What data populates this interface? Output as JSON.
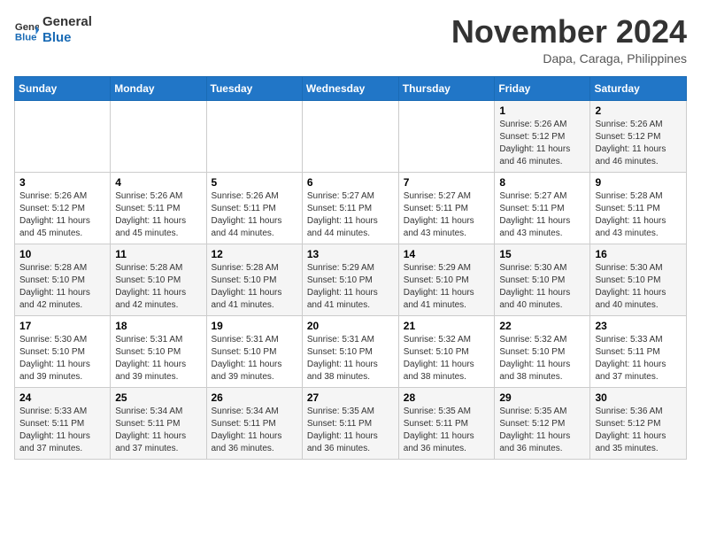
{
  "header": {
    "logo_line1": "General",
    "logo_line2": "Blue",
    "month": "November 2024",
    "location": "Dapa, Caraga, Philippines"
  },
  "weekdays": [
    "Sunday",
    "Monday",
    "Tuesday",
    "Wednesday",
    "Thursday",
    "Friday",
    "Saturday"
  ],
  "weeks": [
    [
      {
        "day": "",
        "info": ""
      },
      {
        "day": "",
        "info": ""
      },
      {
        "day": "",
        "info": ""
      },
      {
        "day": "",
        "info": ""
      },
      {
        "day": "",
        "info": ""
      },
      {
        "day": "1",
        "info": "Sunrise: 5:26 AM\nSunset: 5:12 PM\nDaylight: 11 hours and 46 minutes."
      },
      {
        "day": "2",
        "info": "Sunrise: 5:26 AM\nSunset: 5:12 PM\nDaylight: 11 hours and 46 minutes."
      }
    ],
    [
      {
        "day": "3",
        "info": "Sunrise: 5:26 AM\nSunset: 5:12 PM\nDaylight: 11 hours and 45 minutes."
      },
      {
        "day": "4",
        "info": "Sunrise: 5:26 AM\nSunset: 5:11 PM\nDaylight: 11 hours and 45 minutes."
      },
      {
        "day": "5",
        "info": "Sunrise: 5:26 AM\nSunset: 5:11 PM\nDaylight: 11 hours and 44 minutes."
      },
      {
        "day": "6",
        "info": "Sunrise: 5:27 AM\nSunset: 5:11 PM\nDaylight: 11 hours and 44 minutes."
      },
      {
        "day": "7",
        "info": "Sunrise: 5:27 AM\nSunset: 5:11 PM\nDaylight: 11 hours and 43 minutes."
      },
      {
        "day": "8",
        "info": "Sunrise: 5:27 AM\nSunset: 5:11 PM\nDaylight: 11 hours and 43 minutes."
      },
      {
        "day": "9",
        "info": "Sunrise: 5:28 AM\nSunset: 5:11 PM\nDaylight: 11 hours and 43 minutes."
      }
    ],
    [
      {
        "day": "10",
        "info": "Sunrise: 5:28 AM\nSunset: 5:10 PM\nDaylight: 11 hours and 42 minutes."
      },
      {
        "day": "11",
        "info": "Sunrise: 5:28 AM\nSunset: 5:10 PM\nDaylight: 11 hours and 42 minutes."
      },
      {
        "day": "12",
        "info": "Sunrise: 5:28 AM\nSunset: 5:10 PM\nDaylight: 11 hours and 41 minutes."
      },
      {
        "day": "13",
        "info": "Sunrise: 5:29 AM\nSunset: 5:10 PM\nDaylight: 11 hours and 41 minutes."
      },
      {
        "day": "14",
        "info": "Sunrise: 5:29 AM\nSunset: 5:10 PM\nDaylight: 11 hours and 41 minutes."
      },
      {
        "day": "15",
        "info": "Sunrise: 5:30 AM\nSunset: 5:10 PM\nDaylight: 11 hours and 40 minutes."
      },
      {
        "day": "16",
        "info": "Sunrise: 5:30 AM\nSunset: 5:10 PM\nDaylight: 11 hours and 40 minutes."
      }
    ],
    [
      {
        "day": "17",
        "info": "Sunrise: 5:30 AM\nSunset: 5:10 PM\nDaylight: 11 hours and 39 minutes."
      },
      {
        "day": "18",
        "info": "Sunrise: 5:31 AM\nSunset: 5:10 PM\nDaylight: 11 hours and 39 minutes."
      },
      {
        "day": "19",
        "info": "Sunrise: 5:31 AM\nSunset: 5:10 PM\nDaylight: 11 hours and 39 minutes."
      },
      {
        "day": "20",
        "info": "Sunrise: 5:31 AM\nSunset: 5:10 PM\nDaylight: 11 hours and 38 minutes."
      },
      {
        "day": "21",
        "info": "Sunrise: 5:32 AM\nSunset: 5:10 PM\nDaylight: 11 hours and 38 minutes."
      },
      {
        "day": "22",
        "info": "Sunrise: 5:32 AM\nSunset: 5:10 PM\nDaylight: 11 hours and 38 minutes."
      },
      {
        "day": "23",
        "info": "Sunrise: 5:33 AM\nSunset: 5:11 PM\nDaylight: 11 hours and 37 minutes."
      }
    ],
    [
      {
        "day": "24",
        "info": "Sunrise: 5:33 AM\nSunset: 5:11 PM\nDaylight: 11 hours and 37 minutes."
      },
      {
        "day": "25",
        "info": "Sunrise: 5:34 AM\nSunset: 5:11 PM\nDaylight: 11 hours and 37 minutes."
      },
      {
        "day": "26",
        "info": "Sunrise: 5:34 AM\nSunset: 5:11 PM\nDaylight: 11 hours and 36 minutes."
      },
      {
        "day": "27",
        "info": "Sunrise: 5:35 AM\nSunset: 5:11 PM\nDaylight: 11 hours and 36 minutes."
      },
      {
        "day": "28",
        "info": "Sunrise: 5:35 AM\nSunset: 5:11 PM\nDaylight: 11 hours and 36 minutes."
      },
      {
        "day": "29",
        "info": "Sunrise: 5:35 AM\nSunset: 5:12 PM\nDaylight: 11 hours and 36 minutes."
      },
      {
        "day": "30",
        "info": "Sunrise: 5:36 AM\nSunset: 5:12 PM\nDaylight: 11 hours and 35 minutes."
      }
    ]
  ]
}
